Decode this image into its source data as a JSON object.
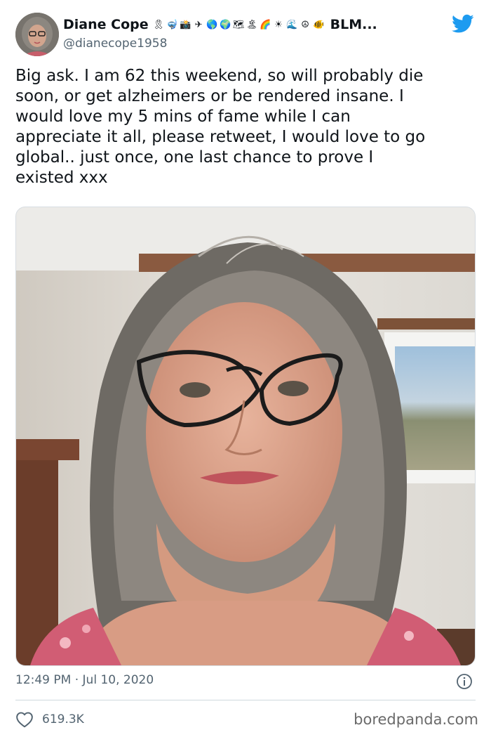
{
  "tweet": {
    "display_name": "Diane Cope",
    "name_suffix": "BLM...",
    "handle": "@dianecope1958",
    "text": "Big ask. I am 62 this weekend, so will probably die\nsoon, or get alzheimers or be rendered insane. I\nwould love my 5 mins of fame while I can\nappreciate it all, please retweet, I would love to go\nglobal.. just once, one last chance to prove I\nexisted xxx",
    "timestamp": "12:49 PM · Jul 10, 2020",
    "likes": "619.3K"
  },
  "name_emojis": [
    {
      "icon": "ribbon-icon",
      "glyph": "🎗"
    },
    {
      "icon": "snorkel-mask-icon",
      "glyph": "🤿"
    },
    {
      "icon": "camera-icon",
      "glyph": "📸"
    },
    {
      "icon": "airplane-icon",
      "glyph": "✈"
    },
    {
      "icon": "globe-americas-icon",
      "glyph": "🌎"
    },
    {
      "icon": "globe-europe-africa-icon",
      "glyph": "🌍"
    },
    {
      "icon": "world-map-icon",
      "glyph": "🗺"
    },
    {
      "icon": "desert-island-icon",
      "glyph": "🏝"
    },
    {
      "icon": "rainbow-icon",
      "glyph": "🌈"
    },
    {
      "icon": "sun-icon",
      "glyph": "☀"
    },
    {
      "icon": "wave-icon",
      "glyph": "🌊"
    },
    {
      "icon": "peace-symbol-icon",
      "glyph": "☮"
    },
    {
      "icon": "tropical-fish-icon",
      "glyph": "🐠"
    }
  ],
  "colors": {
    "twitter_blue": "#1d9bf0",
    "text_primary": "#0f1419",
    "text_secondary": "#536471",
    "divider": "#cfd9de"
  },
  "watermark": "boredpanda.com"
}
